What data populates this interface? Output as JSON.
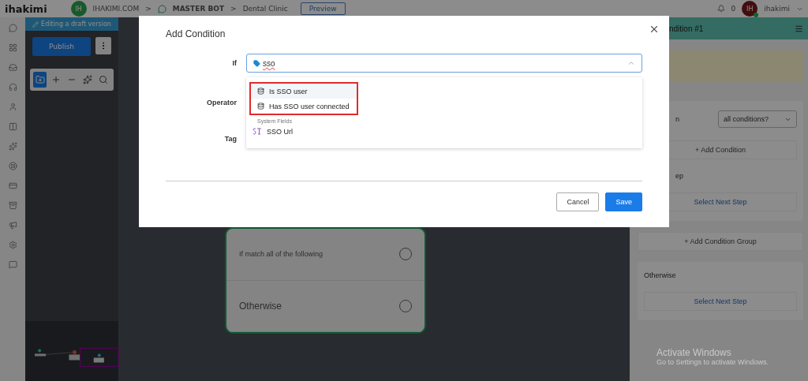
{
  "topbar": {
    "logo": "ihakimi",
    "workspace_avatar": "IH",
    "workspace": "IHAKIMI.COM",
    "separator_1": ">",
    "bot": "MASTER BOT",
    "separator_2": ">",
    "page": "Dental Clinic",
    "preview_button": "Preview",
    "notifications": "0",
    "user_avatar": "IH",
    "user_online": true,
    "user": "ihakimi"
  },
  "editor": {
    "draft_banner": "Editing a draft version",
    "publish_button": "Publish",
    "tools": [
      {
        "kind": "add-node",
        "selected": true
      },
      {
        "kind": "zoom-in",
        "selected": false
      },
      {
        "kind": "zoom-out",
        "selected": false
      },
      {
        "kind": "magic",
        "selected": false
      },
      {
        "kind": "search",
        "selected": false
      }
    ]
  },
  "node": {
    "rows": [
      {
        "kind": "condition",
        "label": "If match all of the following"
      },
      {
        "kind": "fallback",
        "label": "Otherwise"
      }
    ]
  },
  "right_panel": {
    "header": "ndition #1",
    "match_label": "n",
    "match_select": "all conditions?",
    "add_condition": "+ Add Condition",
    "next_step_label": "ep",
    "select_next_step": "Select Next Step",
    "add_condition_group": "+ Add Condition Group",
    "otherwise_label": "Otherwise",
    "otherwise_next_step": "Select Next Step"
  },
  "modal": {
    "title": "Add Condition",
    "fields": [
      {
        "label": "If"
      },
      {
        "label": "Operator"
      },
      {
        "label": "Tag"
      }
    ],
    "if_value": "sso",
    "options": [
      {
        "kind": "tag",
        "label": "Is SSO user",
        "selected": true,
        "highlighted": true
      },
      {
        "kind": "tag",
        "label": "Has SSO user connected",
        "selected": false,
        "highlighted": true
      },
      {
        "kind": "group",
        "label": "System Fields"
      },
      {
        "kind": "field",
        "label": "SSO Url",
        "selected": false,
        "highlighted": false
      }
    ],
    "buttons": [
      {
        "kind": "secondary",
        "label": "Cancel"
      },
      {
        "kind": "primary",
        "label": "Save"
      }
    ]
  },
  "os_notice": {
    "title": "Activate Windows",
    "text": "Go to Settings to activate Windows."
  }
}
